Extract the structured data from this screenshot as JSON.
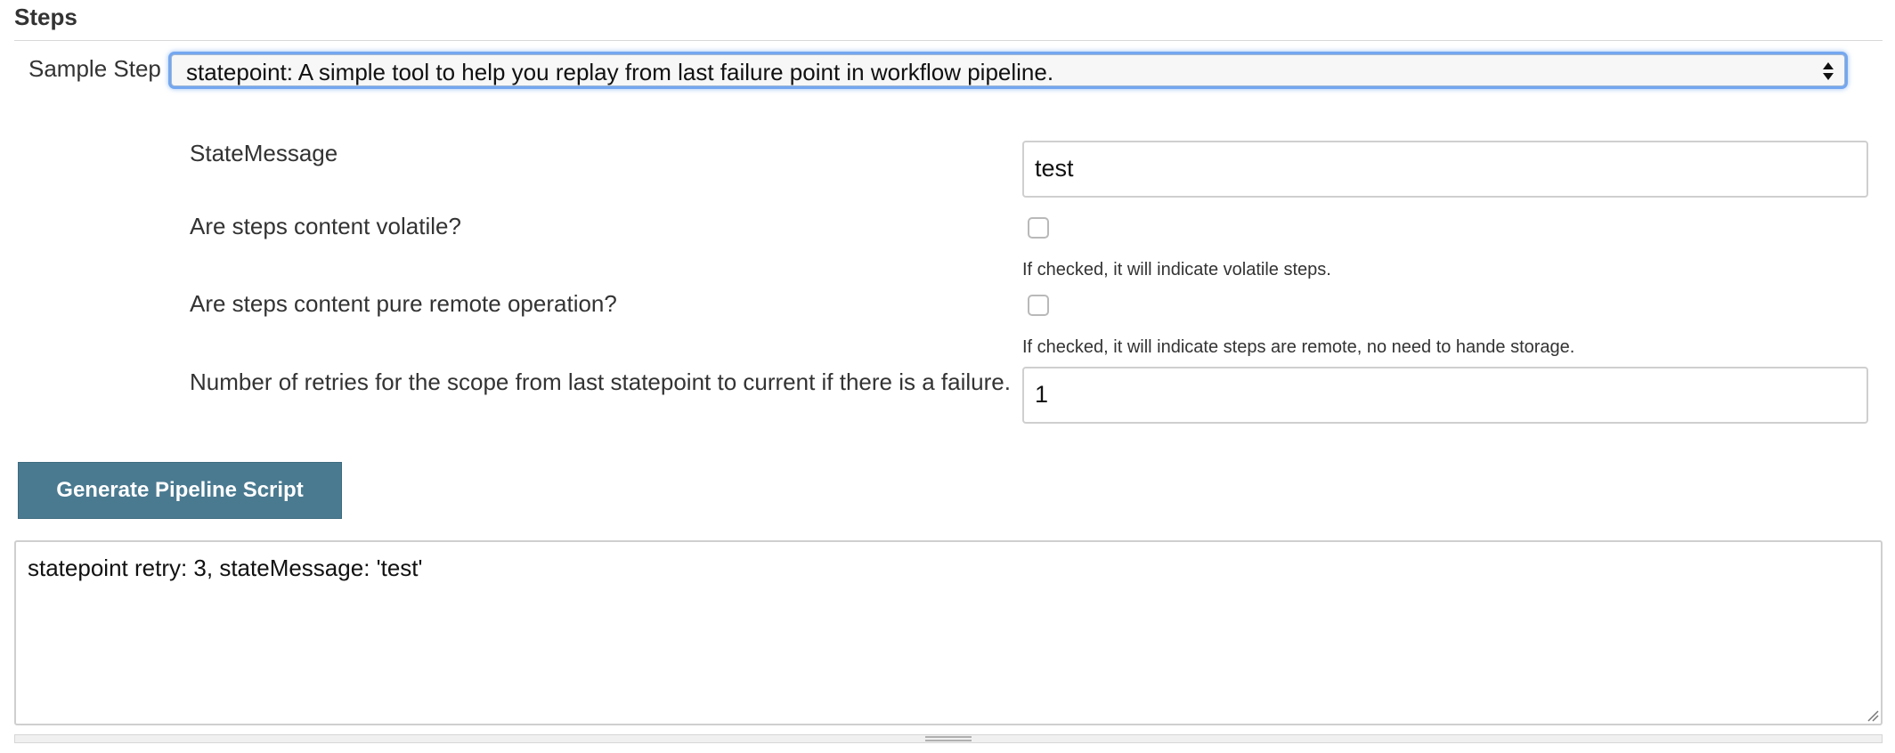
{
  "section": {
    "title": "Steps"
  },
  "sample_step": {
    "label": "Sample Step",
    "selected": "statepoint: A simple tool to help you replay from last failure point in workflow pipeline."
  },
  "fields": {
    "state_message": {
      "label": "StateMessage",
      "value": "test"
    },
    "volatile": {
      "label": "Are steps content volatile?",
      "checked": false,
      "help": "If checked, it will indicate volatile steps."
    },
    "remote": {
      "label": "Are steps content pure remote operation?",
      "checked": false,
      "help": "If checked, it will indicate steps are remote, no need to hande storage."
    },
    "retries": {
      "label": "Number of retries for the scope from last statepoint to current if there is a failure.",
      "value": "1"
    }
  },
  "generate_button": {
    "label": "Generate Pipeline Script"
  },
  "output": {
    "script": "statepoint retry: 3, stateMessage: 'test'"
  },
  "icons": {
    "select_arrows": "select-up-down-arrows-icon",
    "resize": "resize-grip-icon",
    "drag_handle": "drag-handle-icon"
  },
  "colors": {
    "button_bg": "#4a7a90",
    "focus_ring": "#74a7f0"
  }
}
